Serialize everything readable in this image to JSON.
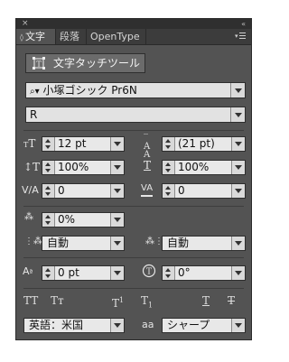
{
  "titlebar": {
    "close_glyph": "×",
    "collapse_glyph": "«"
  },
  "tabs": [
    {
      "label": "文字",
      "active": true
    },
    {
      "label": "段落",
      "active": false
    },
    {
      "label": "OpenType",
      "active": false
    }
  ],
  "touch_tool": {
    "label": "文字タッチツール",
    "icon": "touch-type-icon"
  },
  "font_family": {
    "value": "小塚ゴシック Pr6N",
    "icon": "font-search-icon"
  },
  "font_style": {
    "value": "R"
  },
  "font_size": {
    "value": "12 pt",
    "icon": "font-size-icon"
  },
  "leading": {
    "value": "(21 pt)",
    "icon": "leading-icon"
  },
  "vertical_scale": {
    "value": "100%",
    "icon": "vertical-scale-icon"
  },
  "horizontal_scale": {
    "value": "100%",
    "icon": "horizontal-scale-icon"
  },
  "kerning": {
    "value": "0",
    "icon": "kerning-icon"
  },
  "tracking": {
    "value": "0",
    "icon": "tracking-icon"
  },
  "tsume": {
    "value": "0%",
    "icon": "tsume-icon"
  },
  "aki_left": {
    "value": "自動",
    "icon": "aki-left-icon"
  },
  "aki_right": {
    "value": "自動",
    "icon": "aki-right-icon"
  },
  "baseline_shift": {
    "value": "0 pt",
    "icon": "baseline-shift-icon"
  },
  "rotation": {
    "value": "0°",
    "icon": "character-rotation-icon"
  },
  "styles": {
    "all_caps": "TT",
    "small_caps": "Tт",
    "superscript": "T",
    "superscript_mark": "1",
    "subscript": "T",
    "subscript_mark": "1",
    "underline": "T",
    "strikethrough": "T"
  },
  "language": {
    "value": "英語：米国"
  },
  "antialias": {
    "label": "aa",
    "value": "シャープ"
  },
  "colors": {
    "panel": "#535353",
    "field": "#e8e8e8",
    "tabbar": "#3c3c3c"
  }
}
